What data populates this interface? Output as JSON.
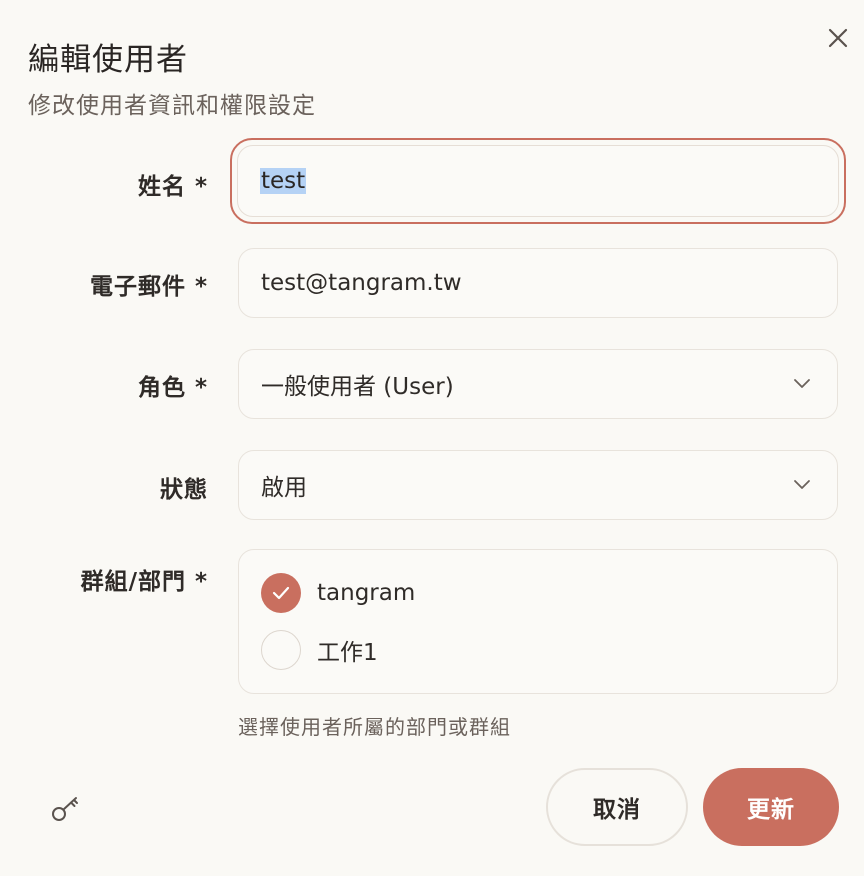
{
  "dialog": {
    "title": "編輯使用者",
    "subtitle": "修改使用者資訊和權限設定"
  },
  "form": {
    "name": {
      "label": "姓名 *",
      "value": "test",
      "selected": true
    },
    "email": {
      "label": "電子郵件 *",
      "value": "test@tangram.tw"
    },
    "role": {
      "label": "角色 *",
      "value": "一般使用者 (User)"
    },
    "status": {
      "label": "狀態",
      "value": "啟用"
    },
    "groups": {
      "label": "群組/部門 *",
      "options": [
        {
          "label": "tangram",
          "checked": true
        },
        {
          "label": "工作1",
          "checked": false
        }
      ],
      "hint": "選擇使用者所屬的部門或群組"
    }
  },
  "buttons": {
    "cancel": "取消",
    "update": "更新"
  },
  "icons": {
    "close": "close-icon",
    "key": "key-icon",
    "chevron": "chevron-down-icon",
    "check": "check-icon"
  },
  "colors": {
    "accent": "#c96f5f",
    "background": "#faf9f5",
    "selection": "#b5d2f5"
  }
}
